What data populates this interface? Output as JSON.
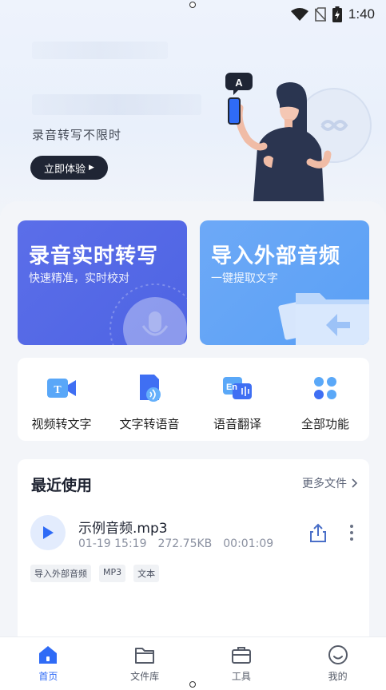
{
  "status_bar": {
    "time": "1:40"
  },
  "hero": {
    "promo_text": "录音转写不限时",
    "try_button": "立即体验"
  },
  "cards": {
    "record": {
      "title": "录音实时转写",
      "subtitle": "快速精准，实时校对"
    },
    "import": {
      "title": "导入外部音频",
      "subtitle": "一键提取文字"
    }
  },
  "tools": [
    {
      "label": "视频转文字",
      "icon": "video-to-text-icon"
    },
    {
      "label": "文字转语音",
      "icon": "text-to-speech-icon"
    },
    {
      "label": "语音翻译",
      "icon": "voice-translate-icon"
    },
    {
      "label": "全部功能",
      "icon": "all-features-icon"
    }
  ],
  "recent": {
    "title": "最近使用",
    "more": "更多文件",
    "file": {
      "name": "示例音频.mp3",
      "date": "01-19 15:19",
      "size": "272.75KB",
      "duration": "00:01:09",
      "tags": [
        "导入外部音频",
        "MP3",
        "文本"
      ]
    }
  },
  "tabbar": [
    {
      "label": "首页",
      "icon": "home-icon",
      "active": true
    },
    {
      "label": "文件库",
      "icon": "folder-icon",
      "active": false
    },
    {
      "label": "工具",
      "icon": "toolbox-icon",
      "active": false
    },
    {
      "label": "我的",
      "icon": "profile-icon",
      "active": false
    }
  ],
  "colors": {
    "accent": "#2f6bf6",
    "record_card": "#5266e4",
    "import_card": "#64a4f6"
  }
}
